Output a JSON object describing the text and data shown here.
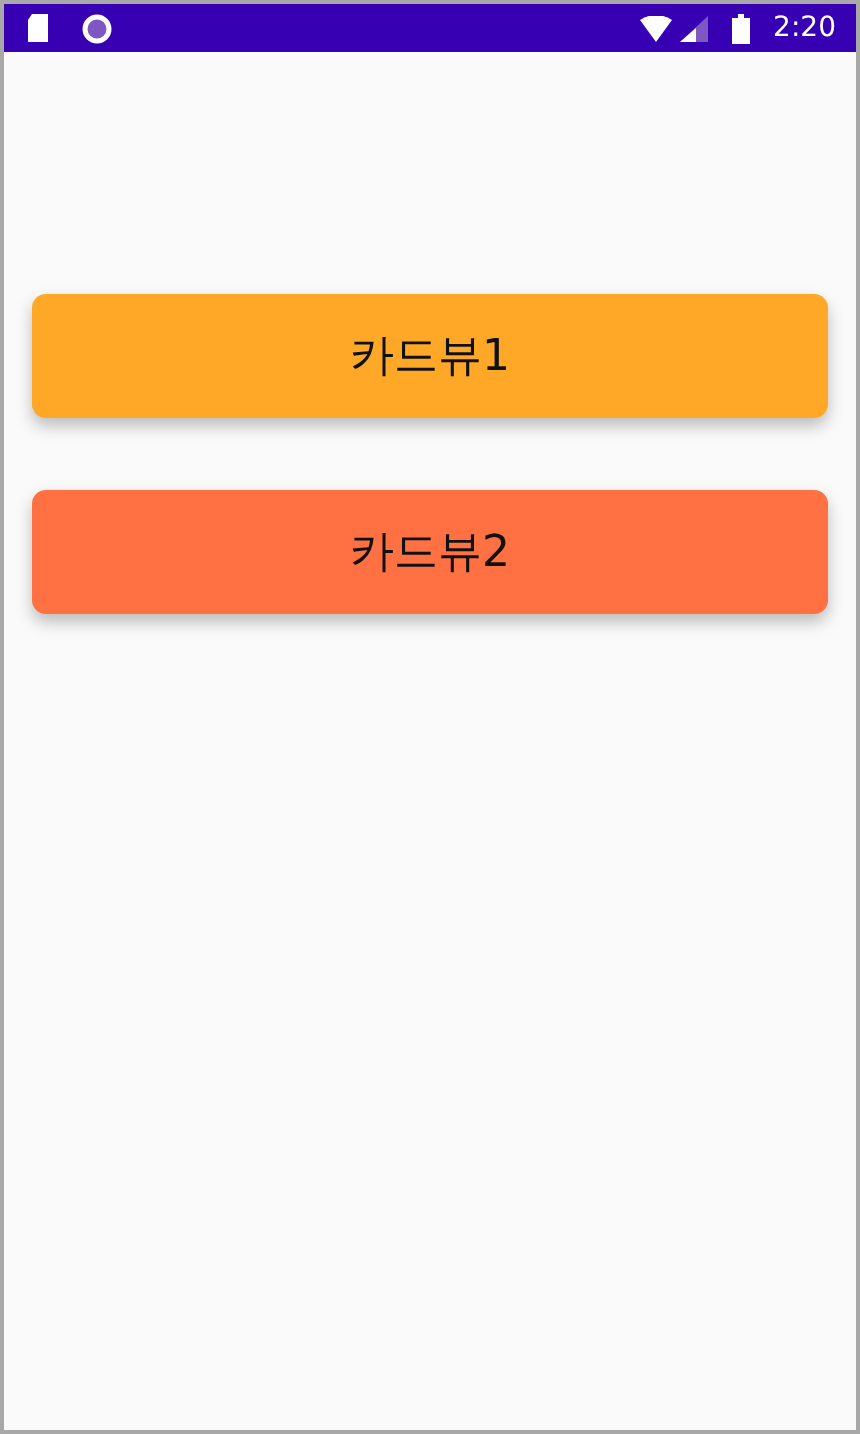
{
  "status_bar": {
    "time": "2:20"
  },
  "cards": [
    {
      "label": "카드뷰1",
      "color": "#ffa726"
    },
    {
      "label": "카드뷰2",
      "color": "#ff7043"
    }
  ]
}
